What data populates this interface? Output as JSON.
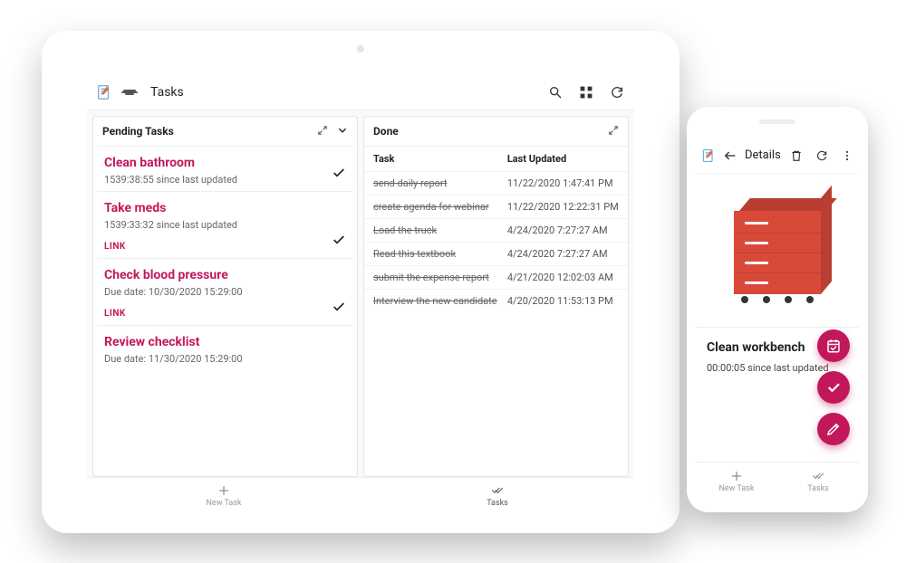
{
  "colors": {
    "accent": "#c2185b"
  },
  "tablet": {
    "title": "Tasks",
    "pending": {
      "header": "Pending Tasks",
      "cards": [
        {
          "title": "Clean bathroom",
          "sub": "1539:38:55 since last updated",
          "link": ""
        },
        {
          "title": "Take meds",
          "sub": "1539:33:32 since last updated",
          "link": "LINK"
        },
        {
          "title": "Check blood pressure",
          "sub": "Due date: 10/30/2020 15:29:00",
          "link": "LINK"
        },
        {
          "title": "Review checklist",
          "sub": "Due date: 11/30/2020 15:29:00",
          "link": ""
        }
      ]
    },
    "done": {
      "header": "Done",
      "col_task": "Task",
      "col_updated": "Last Updated",
      "rows": [
        {
          "task": "send daily report",
          "updated": "11/22/2020 1:47:41 PM"
        },
        {
          "task": "create agenda for webinar",
          "updated": "11/22/2020 12:22:31 PM"
        },
        {
          "task": "Load the truck",
          "updated": "4/24/2020 7:27:27 AM"
        },
        {
          "task": "Read this textbook",
          "updated": "4/24/2020 7:27:27 AM"
        },
        {
          "task": "submit the expense report",
          "updated": "4/21/2020 12:02:03 AM"
        },
        {
          "task": "Interview the new candidate",
          "updated": "4/20/2020 11:53:13 PM"
        }
      ]
    },
    "bottomnav": {
      "new_task": "New Task",
      "tasks": "Tasks"
    }
  },
  "phone": {
    "title": "Details",
    "task_title": "Clean workbench",
    "task_sub": "00:00:05 since last updated",
    "bottomnav": {
      "new_task": "New Task",
      "tasks": "Tasks"
    }
  }
}
